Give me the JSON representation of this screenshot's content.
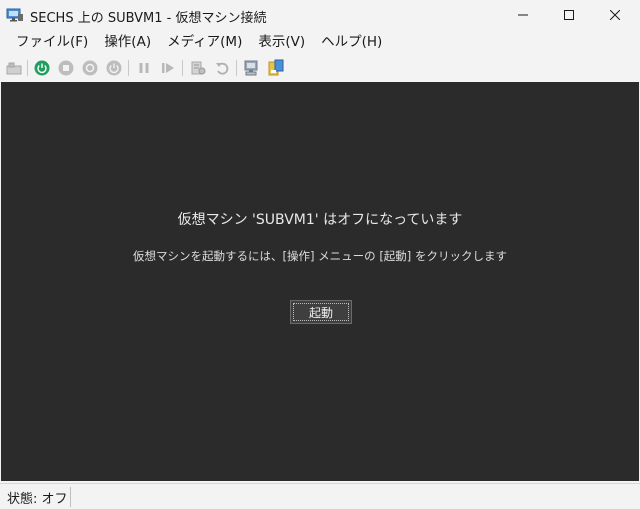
{
  "window": {
    "title": "SECHS 上の SUBVM1 - 仮想マシン接続",
    "app_icon": "vm-connect-icon"
  },
  "menu": [
    {
      "label": "ファイル(F)"
    },
    {
      "label": "操作(A)"
    },
    {
      "label": "メディア(M)"
    },
    {
      "label": "表示(V)"
    },
    {
      "label": "ヘルプ(H)"
    }
  ],
  "toolbar": {
    "icons": [
      "ctrl-alt-del-icon",
      "power-on-icon",
      "stop-icon",
      "shutdown-icon",
      "power-off-icon",
      "pause-icon",
      "resume-icon",
      "checkpoint-icon",
      "revert-icon",
      "enhanced-session-icon",
      "share-icon"
    ]
  },
  "console": {
    "title": "仮想マシン 'SUBVM1' はオフになっています",
    "hint": "仮想マシンを起動するには、[操作] メニューの [起動] をクリックします",
    "start_button": "起動"
  },
  "status": {
    "text": "状態: オフ"
  },
  "colors": {
    "console_bg": "#2b2b2b",
    "power_on_green": "#1f9e60",
    "chrome_bg": "#f3f3f3"
  }
}
